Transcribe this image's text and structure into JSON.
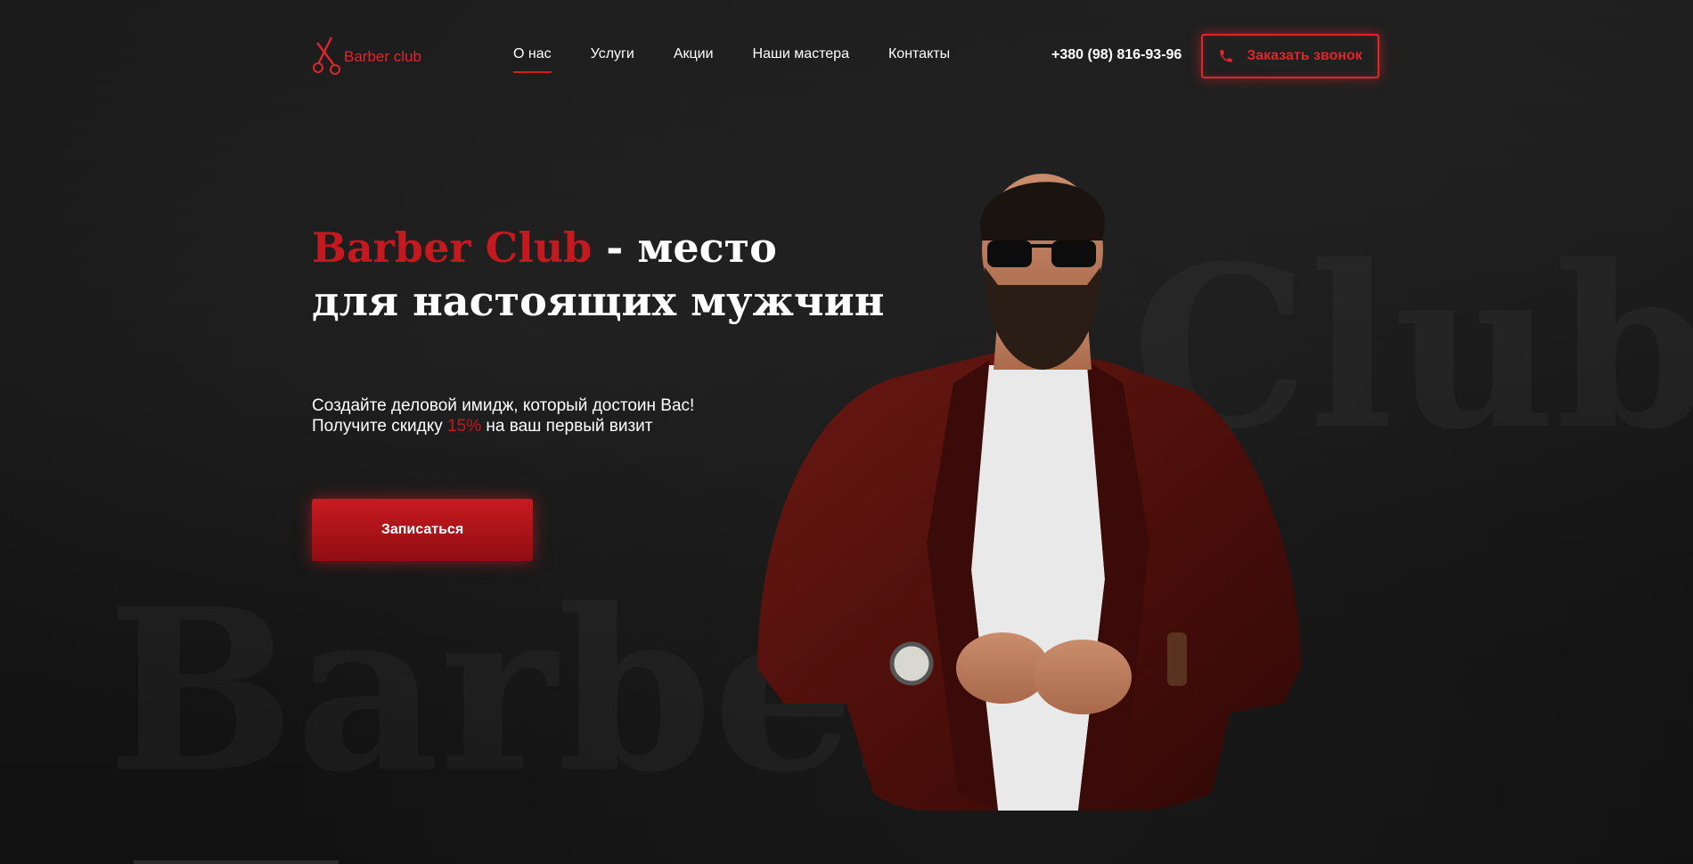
{
  "brand": {
    "logo_text": "Barber club",
    "accent_color": "#c4191e"
  },
  "nav": {
    "items": [
      {
        "label": "О нас",
        "active": true
      },
      {
        "label": "Услуги",
        "active": false
      },
      {
        "label": "Акции",
        "active": false
      },
      {
        "label": "Наши мастера",
        "active": false
      },
      {
        "label": "Контакты",
        "active": false
      }
    ]
  },
  "header": {
    "phone": "+380 (98) 816-93-96",
    "callback_label": "Заказать звонок",
    "callback_icon": "phone-icon"
  },
  "hero": {
    "title_accent": "Barber Club",
    "title_rest": " - место",
    "title_line2": "для настоящих мужчин",
    "subtitle_line1": "Создайте деловой имидж, который достоин Вас!",
    "subtitle_line2_prefix": "Получите скидку ",
    "subtitle_discount": "15%",
    "subtitle_line2_suffix": " на ваш первый визит",
    "cta_label": "Записаться"
  },
  "background": {
    "ghost_word_left": "Barber",
    "ghost_word_right": "Club"
  }
}
